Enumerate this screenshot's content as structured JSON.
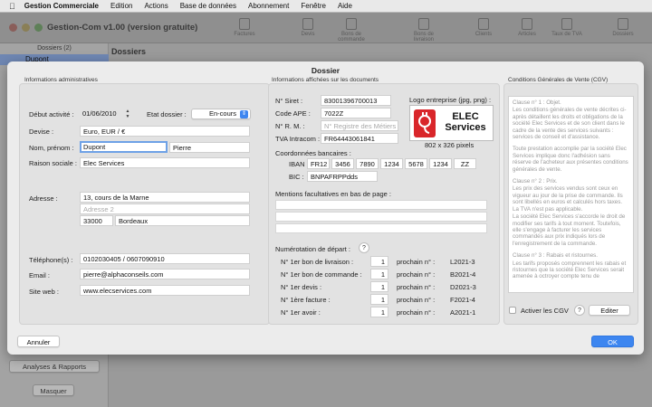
{
  "menubar": {
    "app_name": "Gestion Commerciale",
    "items": [
      "Edition",
      "Actions",
      "Base de données",
      "Abonnement",
      "Fenêtre",
      "Aide"
    ]
  },
  "background_window": {
    "title": "Gestion-Com v1.00 (version gratuite)",
    "toolbar": [
      "Factures",
      "Devis",
      "Bons de commande",
      "Bons de livraison",
      "Clients",
      "Articles",
      "Taux de TVA",
      "Dossiers"
    ],
    "sidebar_header": "Dossiers (2)",
    "sidebar_selected": "Dupont",
    "sidebar_buttons": [
      "Analyses & Rapports",
      "Masquer"
    ],
    "main_title": "Dossiers"
  },
  "sheet": {
    "title": "Dossier",
    "admin": {
      "section_label": "Informations administratives",
      "debut_label": "Début activité :",
      "debut_value": "01/06/2010",
      "etat_label": "Etat dossier :",
      "etat_value": "En-cours",
      "devise_label": "Devise :",
      "devise_value": "Euro, EUR / €",
      "nom_label": "Nom, prénom :",
      "nom_value": "Dupont",
      "prenom_value": "Pierre",
      "raison_label": "Raison sociale :",
      "raison_value": "Elec Services",
      "adresse_label": "Adresse :",
      "adresse1_value": "13, cours de la Marne",
      "adresse2_placeholder": "Adresse 2",
      "cp_value": "33000",
      "ville_value": "Bordeaux",
      "tel_label": "Téléphone(s) :",
      "tel_value": "0102030405 / 0607090910",
      "email_label": "Email :",
      "email_value": "pierre@alphaconseils.com",
      "site_label": "Site web :",
      "site_value": "www.elecservices.com"
    },
    "docs": {
      "section_label": "Informations affichées sur les documents",
      "siret_label": "N° Siret :",
      "siret_value": "83001396700013",
      "ape_label": "Code APE :",
      "ape_value": "7022Z",
      "rm_label": "N° R. M. :",
      "rm_placeholder": "N° Registre des Métiers",
      "tva_label": "TVA Intracom :",
      "tva_value": "FR64443061841",
      "logo_label": "Logo entreprise (jpg, png) :",
      "logo_text_line1": "ELEC",
      "logo_text_line2": "Services",
      "logo_size": "802 x 326 pixels",
      "bank_label": "Coordonnées bancaires :",
      "iban_label": "IBAN :",
      "iban_parts": [
        "FR12",
        "3456",
        "7890",
        "1234",
        "5678",
        "1234",
        "ZZ"
      ],
      "bic_label": "BIC :",
      "bic_value": "BNPAFRPPdds",
      "mentions_label": "Mentions facultatives en bas de page :",
      "numerotation_label": "Numérotation de départ :",
      "help": "?",
      "numbers": [
        {
          "label": "N° 1er bon de livraison :",
          "value": "1",
          "prochain_label": "prochain n° :",
          "next": "L2021-3"
        },
        {
          "label": "N° 1er bon de commande :",
          "value": "1",
          "prochain_label": "prochain n° :",
          "next": "B2021-4"
        },
        {
          "label": "N° 1er devis :",
          "value": "1",
          "prochain_label": "prochain n° :",
          "next": "D2021-3"
        },
        {
          "label": "N° 1ère facture :",
          "value": "1",
          "prochain_label": "prochain n° :",
          "next": "F2021-4"
        },
        {
          "label": "N° 1er avoir :",
          "value": "1",
          "prochain_label": "prochain n° :",
          "next": "A2021-1"
        }
      ]
    },
    "cgv": {
      "section_label": "Conditions Générales de Vente (CGV)",
      "paragraphs": [
        "Clause n° 1 : Objet.",
        "Les conditions générales de vente décrites ci-après détaillent les droits et obligations de la société Elec Services et de son client dans le cadre de la vente des services suivants : services de conseil et d'assistance.",
        "Toute prestation accomplie par la société Elec Services implique donc l'adhésion sans réserve de l'acheteur aux présentes conditions générales de vente.",
        "Clause n° 2 : Prix.",
        "Les prix des services vendus sont ceux en vigueur au jour de la prise de commande. Ils sont libellés en euros et calculés hors taxes. La TVA n'est pas applicable.",
        "La société Elec Services s'accorde le droit de modifier ses tarifs à tout moment. Toutefois, elle s'engage à facturer les services commandés aux prix indiqués lors de l'enregistrement de la commande.",
        "Clause n° 3 : Rabais et ristournes.",
        "Les tarifs proposés comprennent les rabais et ristournes que la société Elec Services serait amenée à octroyer compte tenu de"
      ],
      "activer_label": "Activer les CGV",
      "help": "?",
      "editer_label": "Editer"
    },
    "annuler_label": "Annuler",
    "ok_label": "OK"
  }
}
